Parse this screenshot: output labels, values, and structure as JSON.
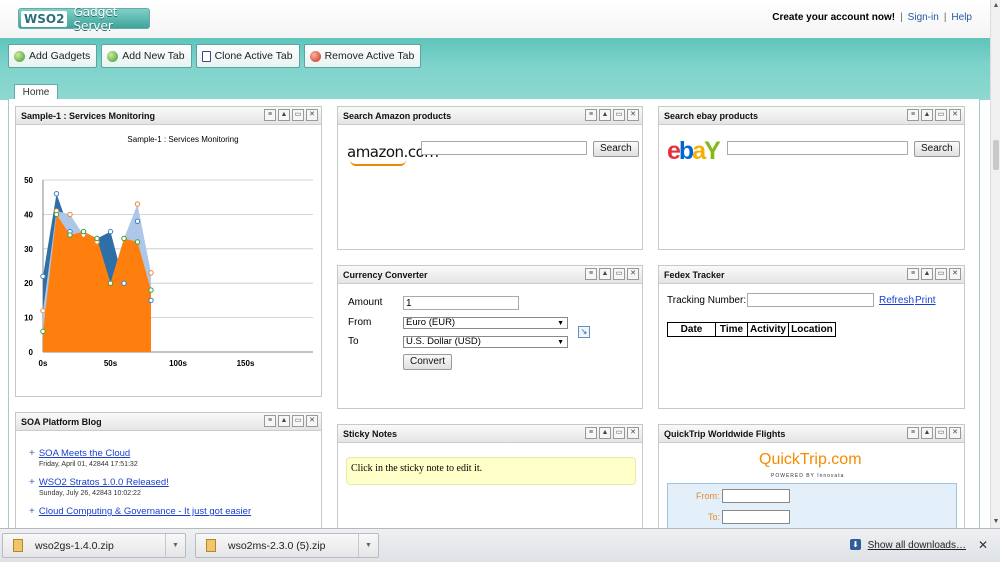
{
  "header": {
    "logo_wso": "WSO2",
    "logo_name": "Gadget Server",
    "create_account": "Create your account now!",
    "sign_in": "Sign-in",
    "help": "Help",
    "separator": "|"
  },
  "toolbar": {
    "add_gadgets": "Add Gadgets",
    "add_new_tab": "Add New Tab",
    "clone_active_tab": "Clone Active Tab",
    "remove_active_tab": "Remove Active Tab"
  },
  "tabs": [
    {
      "label": "Home"
    }
  ],
  "gadget_controls": [
    "settings-icon",
    "collapse-icon",
    "maximize-icon",
    "close-icon"
  ],
  "gadgets": {
    "services_monitoring": {
      "title": "Sample-1 : Services Monitoring",
      "chart_title": "Sample-1 : Services Monitoring"
    },
    "amazon": {
      "title": "Search Amazon products",
      "logo": "amazon.com",
      "search_button": "Search",
      "search_value": ""
    },
    "ebay": {
      "title": "Search ebay products",
      "logo_e": "e",
      "logo_b": "b",
      "logo_a": "a",
      "logo_y": "Y",
      "search_button": "Search",
      "search_value": ""
    },
    "currency": {
      "title": "Currency Converter",
      "amount_label": "Amount",
      "amount_value": "1",
      "from_label": "From",
      "from_value": "Euro (EUR)",
      "to_label": "To",
      "to_value": "U.S. Dollar (USD)",
      "convert_button": "Convert"
    },
    "fedex": {
      "title": "Fedex Tracker",
      "tracking_label": "Tracking Number:",
      "tracking_value": "",
      "refresh": "Refresh",
      "print": "Print",
      "columns": [
        "Date",
        "Time",
        "Activity",
        "Location"
      ]
    },
    "blog": {
      "title": "SOA Platform Blog",
      "posts": [
        {
          "title": "SOA Meets the Cloud",
          "date": "Friday, April 01, 42844 17:51:32"
        },
        {
          "title": "WSO2 Stratos 1.0.0 Released!",
          "date": "Sunday, July 26, 42843 10:02:22"
        },
        {
          "title": "Cloud Computing & Governance - It just got easier",
          "date": ""
        }
      ]
    },
    "sticky": {
      "title": "Sticky Notes",
      "note": "Click in the sticky note to edit it."
    },
    "quicktrip": {
      "title": "QuickTrip Worldwide Flights",
      "logo": "QuickTrip.com",
      "powered": "POWERED BY",
      "powered_by": "Innovata",
      "from_label": "From:",
      "to_label": "To:"
    }
  },
  "chart_data": {
    "type": "area",
    "title": "Sample-1 : Services Monitoring",
    "xlabel": "",
    "ylabel": "",
    "x_ticks": [
      "0s",
      "50s",
      "100s",
      "150s"
    ],
    "y_ticks": [
      0,
      10,
      20,
      30,
      40,
      50
    ],
    "xlim": [
      0,
      200
    ],
    "ylim": [
      0,
      50
    ],
    "grid": true,
    "colors": [
      "#2e6fa8",
      "#aec7e8",
      "#ff7f0e"
    ],
    "series": [
      {
        "x": [
          0,
          10,
          20,
          30,
          40,
          50,
          60,
          70,
          80
        ],
        "values": [
          22,
          46,
          35,
          35,
          33,
          35,
          20,
          38,
          15
        ]
      },
      {
        "x": [
          0,
          10,
          20,
          30,
          40,
          50,
          60,
          70,
          80
        ],
        "values": [
          12,
          41,
          40,
          34,
          32,
          20,
          33,
          43,
          23
        ]
      },
      {
        "x": [
          0,
          10,
          20,
          30,
          40,
          50,
          60,
          70,
          80
        ],
        "values": [
          6,
          40,
          34,
          35,
          33,
          20,
          33,
          32,
          18
        ]
      }
    ]
  },
  "downloads": {
    "items": [
      {
        "name": "wso2gs-1.4.0.zip"
      },
      {
        "name": "wso2ms-2.3.0 (5).zip"
      }
    ],
    "show_all": "Show all downloads…"
  }
}
